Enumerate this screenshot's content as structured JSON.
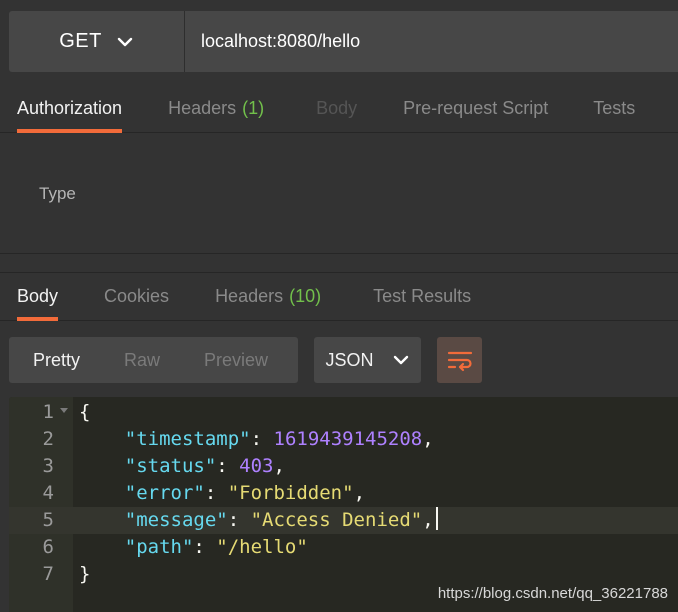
{
  "request": {
    "method": "GET",
    "url": "localhost:8080/hello"
  },
  "request_tabs": [
    {
      "label": "Authorization",
      "count": "",
      "state": "active"
    },
    {
      "label": "Headers",
      "count": "(1)",
      "state": "normal"
    },
    {
      "label": "Body",
      "count": "",
      "state": "disabled"
    },
    {
      "label": "Pre-request Script",
      "count": "",
      "state": "normal"
    },
    {
      "label": "Tests",
      "count": "",
      "state": "normal"
    }
  ],
  "auth": {
    "type_label": "Type"
  },
  "response_tabs": [
    {
      "label": "Body",
      "count": "",
      "state": "active"
    },
    {
      "label": "Cookies",
      "count": "",
      "state": "normal"
    },
    {
      "label": "Headers",
      "count": "(10)",
      "state": "normal"
    },
    {
      "label": "Test Results",
      "count": "",
      "state": "normal"
    }
  ],
  "view_modes": [
    {
      "label": "Pretty",
      "active": true
    },
    {
      "label": "Raw",
      "active": false
    },
    {
      "label": "Preview",
      "active": false
    }
  ],
  "format": "JSON",
  "icons": {
    "method_dropdown": "chevron-down-icon",
    "format_dropdown": "chevron-down-icon",
    "wrap": "wrap-lines-icon",
    "fold": "fold-arrow-icon"
  },
  "colors": {
    "accent": "#f26b3a",
    "count": "#72c04b",
    "json_key": "#66d9ef",
    "json_number": "#ae81ff",
    "json_string": "#e6db74"
  },
  "code_lines": [
    {
      "n": "1",
      "indent": "",
      "key": "",
      "sep": "",
      "value": "",
      "vtype": "",
      "punc": "{"
    },
    {
      "n": "2",
      "indent": "    ",
      "key": "\"timestamp\"",
      "sep": ": ",
      "value": "1619439145208",
      "vtype": "num",
      "punc": ","
    },
    {
      "n": "3",
      "indent": "    ",
      "key": "\"status\"",
      "sep": ": ",
      "value": "403",
      "vtype": "num",
      "punc": ","
    },
    {
      "n": "4",
      "indent": "    ",
      "key": "\"error\"",
      "sep": ": ",
      "value": "\"Forbidden\"",
      "vtype": "str",
      "punc": ","
    },
    {
      "n": "5",
      "indent": "    ",
      "key": "\"message\"",
      "sep": ": ",
      "value": "\"Access Denied\"",
      "vtype": "str",
      "punc": ","
    },
    {
      "n": "6",
      "indent": "    ",
      "key": "\"path\"",
      "sep": ": ",
      "value": "\"/hello\"",
      "vtype": "str",
      "punc": ""
    },
    {
      "n": "7",
      "indent": "",
      "key": "",
      "sep": "",
      "value": "",
      "vtype": "",
      "punc": "}"
    }
  ],
  "current_line": "5",
  "watermark": "https://blog.csdn.net/qq_36221788"
}
